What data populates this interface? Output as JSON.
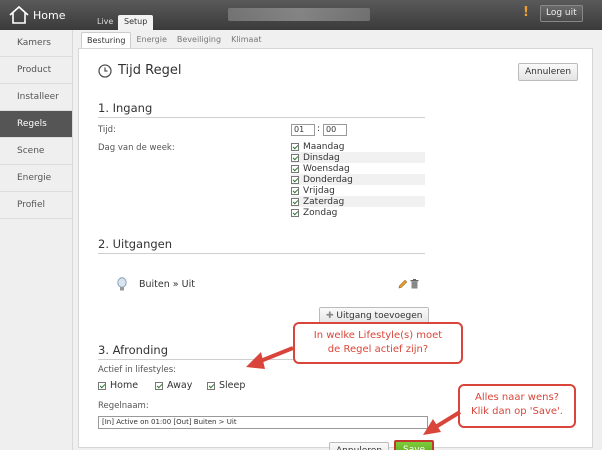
{
  "topbar": {
    "logo_text": "Home",
    "tabs": [
      "Live",
      "Setup"
    ],
    "logout_label": "Log uit",
    "alert_symbol": "!"
  },
  "sidebar": {
    "items": [
      "Kamers",
      "Product",
      "Installeer",
      "Regels",
      "Scene",
      "Energie",
      "Profiel"
    ],
    "active": "Regels"
  },
  "subtabs": [
    "Besturing",
    "Energie",
    "Beveiliging",
    "Klimaat"
  ],
  "page": {
    "title": "Tijd Regel",
    "cancel_label": "Annuleren"
  },
  "ingang": {
    "title": "1. Ingang",
    "time_label": "Tijd:",
    "hours": "01",
    "minutes": "00",
    "days_label": "Dag van de week:",
    "days": [
      "Maandag",
      "Dinsdag",
      "Woensdag",
      "Donderdag",
      "Vrijdag",
      "Zaterdag",
      "Zondag"
    ]
  },
  "uitgangen": {
    "title": "2. Uitgangen",
    "output_label": "Buiten » Uit",
    "add_label": "Uitgang toevoegen"
  },
  "afronding": {
    "title": "3. Afronding",
    "lifestyles_label": "Actief in lifestyles:",
    "lifestyles": [
      "Home",
      "Away",
      "Sleep"
    ],
    "rule_name_label": "Regelnaam:",
    "rule_name_value": "[In] Active on 01:00  [Out] Buiten > Uit",
    "cancel_label": "Annuleren",
    "save_label": "Save"
  },
  "callouts": {
    "lifestyle_line1": "In welke Lifestyle(s) moet",
    "lifestyle_line2": "de Regel actief zijn?",
    "save_line1": "Alles naar wens?",
    "save_line2": "Klik dan op 'Save'."
  },
  "colors": {
    "callout": "#d9453a",
    "save_button": "#6bbb2c",
    "sidebar_active": "#555555"
  }
}
